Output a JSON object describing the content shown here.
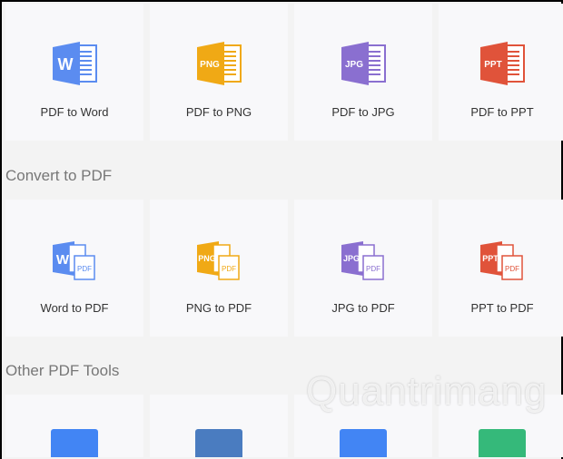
{
  "sections": [
    {
      "title": "",
      "items": [
        {
          "label": "PDF to Word",
          "icon": "word-icon",
          "badge": "W",
          "color": "#5b8cf0"
        },
        {
          "label": "PDF to PNG",
          "icon": "png-icon",
          "badge": "PNG",
          "color": "#f0a915"
        },
        {
          "label": "PDF to JPG",
          "icon": "jpg-icon",
          "badge": "JPG",
          "color": "#8a6fd0"
        },
        {
          "label": "PDF to PPT",
          "icon": "ppt-icon",
          "badge": "PPT",
          "color": "#e0533a"
        }
      ]
    },
    {
      "title": "Convert to PDF",
      "items": [
        {
          "label": "Word to PDF",
          "icon": "word-to-pdf-icon",
          "badge": "W",
          "color": "#5b8cf0"
        },
        {
          "label": "PNG to PDF",
          "icon": "png-to-pdf-icon",
          "badge": "PNG",
          "color": "#f0a915"
        },
        {
          "label": "JPG to PDF",
          "icon": "jpg-to-pdf-icon",
          "badge": "JPG",
          "color": "#8a6fd0"
        },
        {
          "label": "PPT to PDF",
          "icon": "ppt-to-pdf-icon",
          "badge": "PPT",
          "color": "#e0533a"
        }
      ],
      "pdf_tag": "PDF"
    },
    {
      "title": "Other PDF Tools",
      "items": [
        {
          "icon": "edit-pdf-icon",
          "color": "#4285f4"
        },
        {
          "icon": "image-pdf-icon",
          "color": "#4a7cc0"
        },
        {
          "icon": "compress-pdf-icon",
          "color": "#4285f4"
        },
        {
          "icon": "split-pdf-icon",
          "color": "#35b97a"
        }
      ]
    }
  ],
  "watermark": "Quantrimang"
}
